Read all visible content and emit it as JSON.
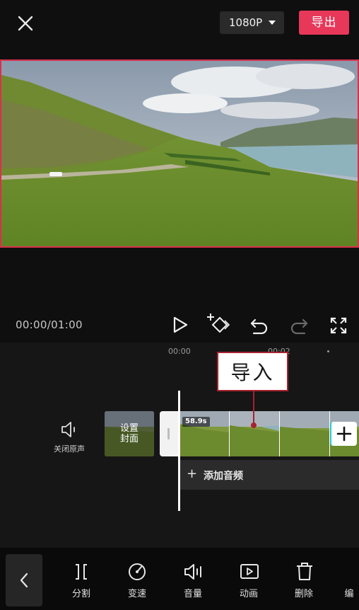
{
  "header": {
    "resolution_label": "1080P",
    "export_label": "导出"
  },
  "player": {
    "time_code": "00:00/01:00"
  },
  "timeline": {
    "ruler": [
      "00:00",
      "00:02"
    ],
    "mute_label": "关闭原声",
    "cover_label_line1": "设置",
    "cover_label_line2": "封面",
    "clip_duration": "58.9s",
    "add_audio_label": "添加音频"
  },
  "callout": {
    "text": "导入"
  },
  "toolbar": {
    "items": [
      {
        "label": "分割",
        "icon": "split-icon"
      },
      {
        "label": "变速",
        "icon": "speed-icon"
      },
      {
        "label": "音量",
        "icon": "volume-icon"
      },
      {
        "label": "动画",
        "icon": "animation-icon"
      },
      {
        "label": "删除",
        "icon": "delete-icon"
      },
      {
        "label": "编",
        "icon": "edit-icon"
      }
    ]
  },
  "colors": {
    "accent": "#e8385a",
    "callout": "#a7232f",
    "background": "#0f0f0f"
  }
}
